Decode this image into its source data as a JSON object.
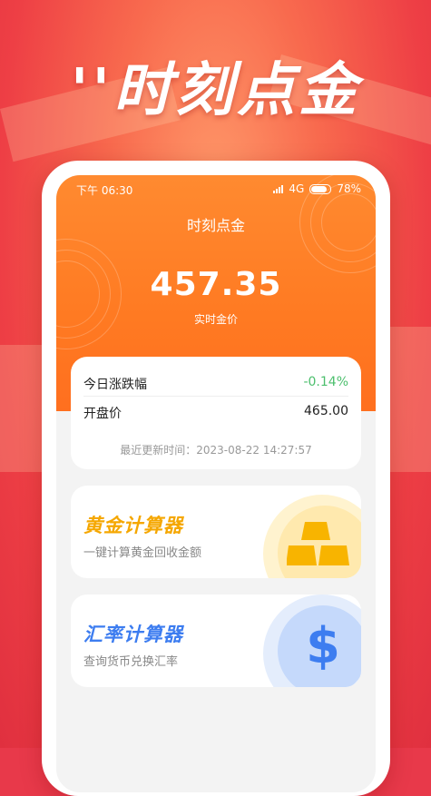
{
  "banner": {
    "title": "''时刻点金"
  },
  "status_bar": {
    "time": "下午 06:30",
    "network": "4G",
    "battery": "78%"
  },
  "header": {
    "title": "时刻点金"
  },
  "gold_price": {
    "value": "457.35",
    "label": "实时金价"
  },
  "market": {
    "change_label": "今日涨跌幅",
    "change_value": "-0.14%",
    "open_label": "开盘价",
    "open_value": "465.00",
    "updated": "最近更新时间：2023-08-22  14:27:57"
  },
  "tools": [
    {
      "title": "黄金计算器",
      "subtitle": "一键计算黄金回收金额",
      "icon": "gold-bars-icon",
      "color": "#f5a700"
    },
    {
      "title": "汇率计算器",
      "subtitle": "查询货币兑换汇率",
      "icon": "dollar-icon",
      "color": "#3d7df0"
    }
  ],
  "colors": {
    "accent": "#ff7a22",
    "background": "#e8394a",
    "change_negative": "#4cbf6d"
  }
}
